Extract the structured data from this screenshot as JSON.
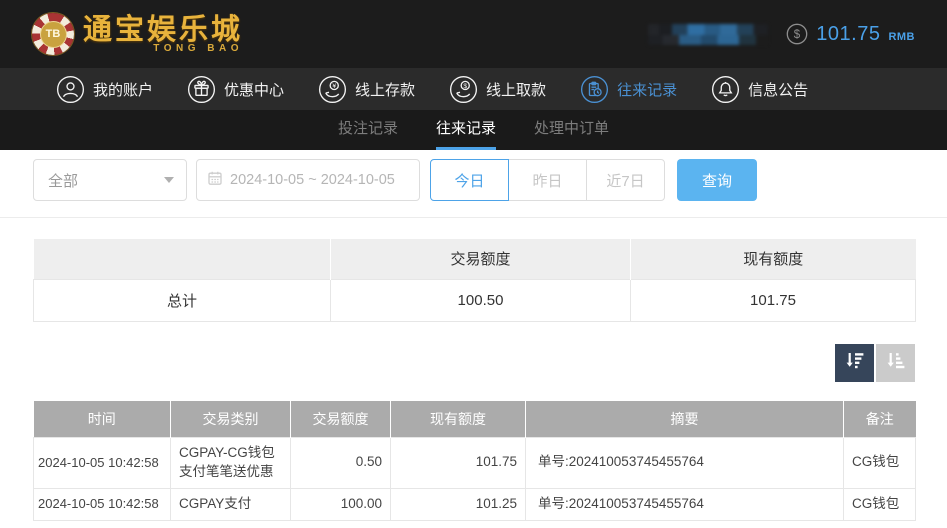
{
  "colors": {
    "accent_blue": "#4da3e8",
    "nav_active_blue": "#4a90d2",
    "search_button_blue": "#5bb4f0",
    "logo_gold": "#e8b33c",
    "topbar_bg": "#1c1c1c",
    "mainnav_bg": "#2b2b2b",
    "subnav_bg": "#1a1a1a",
    "table_header_gray": "#ababab",
    "summary_header_gray": "#eeeeee",
    "sort_dark": "#36455a",
    "sort_light": "#cbcbcb"
  },
  "header": {
    "logo": {
      "chip_text": "TB",
      "name": "通宝娱乐城",
      "subname": "TONG BAO"
    },
    "username_redacted": true,
    "balance": {
      "icon": "dollar-circle-icon",
      "amount": "101.75",
      "currency": "RMB"
    }
  },
  "nav": {
    "items": [
      {
        "label": "我的账户",
        "icon": "user-icon"
      },
      {
        "label": "优惠中心",
        "icon": "gift-icon"
      },
      {
        "label": "线上存款",
        "icon": "deposit-icon"
      },
      {
        "label": "线上取款",
        "icon": "withdraw-icon"
      },
      {
        "label": "往来记录",
        "icon": "records-icon",
        "active": true
      },
      {
        "label": "信息公告",
        "icon": "bell-icon"
      }
    ]
  },
  "subnav": {
    "tabs": [
      {
        "label": "投注记录"
      },
      {
        "label": "往来记录",
        "active": true
      },
      {
        "label": "处理中订单"
      }
    ]
  },
  "filters": {
    "type_select": {
      "value": "全部"
    },
    "date_range": {
      "value": "2024-10-05 ~ 2024-10-05",
      "icon": "calendar-icon"
    },
    "quick_buttons": [
      "今日",
      "昨日",
      "近7日"
    ],
    "active_quick": "今日",
    "search_label": "查询"
  },
  "summary_table": {
    "col_headers": [
      "",
      "交易额度",
      "现有额度"
    ],
    "row": {
      "label": "总计",
      "trade_amount": "100.50",
      "current_amount": "101.75"
    }
  },
  "sort_buttons": {
    "icons": [
      "sort-desc-icon",
      "sort-asc-icon"
    ]
  },
  "records_table": {
    "headers": [
      "时间",
      "交易类别",
      "交易额度",
      "现有额度",
      "摘要",
      "备注"
    ],
    "rows": [
      {
        "time": "2024-10-05 10:42:58",
        "category": "CGPAY-CG钱包支付笔笔送优惠",
        "amount": "0.50",
        "balance": "101.75",
        "summary": "单号:202410053745455764",
        "note": "CG钱包"
      },
      {
        "time": "2024-10-05 10:42:58",
        "category": "CGPAY支付",
        "amount": "100.00",
        "balance": "101.25",
        "summary": "单号:202410053745455764",
        "note": "CG钱包"
      }
    ]
  }
}
